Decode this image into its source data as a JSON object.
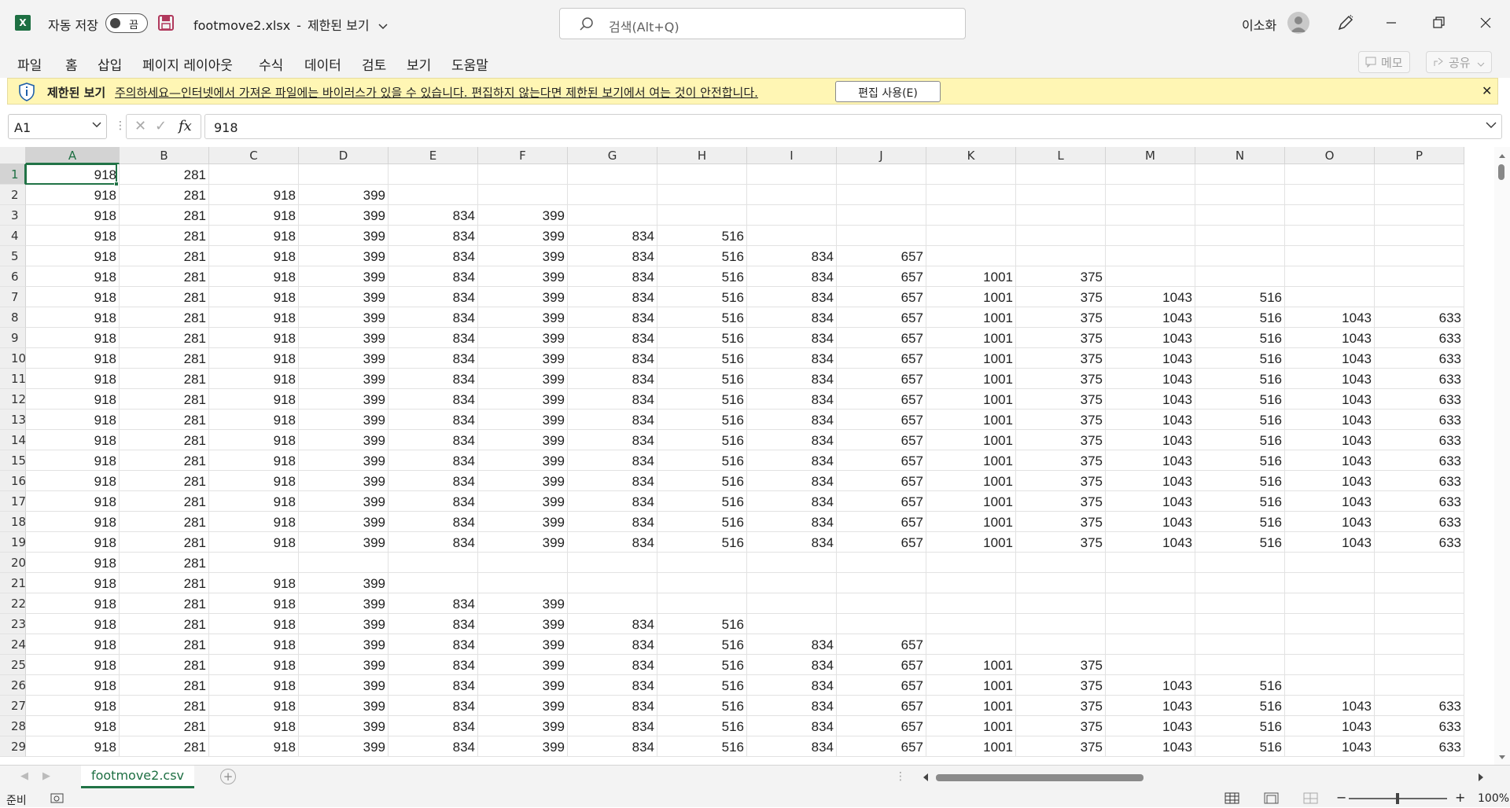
{
  "titlebar": {
    "autosave_label": "자동 저장",
    "autosave_state": "끔",
    "filename": "footmove2.xlsx",
    "separator": "-",
    "mode": "제한된 보기",
    "search_placeholder": "검색(Alt+Q)",
    "user": "이소화"
  },
  "ribbon": {
    "tabs": [
      "파일",
      "홈",
      "삽입",
      "페이지 레이아웃",
      "수식",
      "데이터",
      "검토",
      "보기",
      "도움말"
    ],
    "memo": "메모",
    "share": "공유"
  },
  "message_bar": {
    "title": "제한된 보기",
    "text": "주의하세요—인터넷에서 가져온 파일에는 바이러스가 있을 수 있습니다. 편집하지 않는다면 제한된 보기에서 여는 것이 안전합니다.",
    "button": "편집 사용(E)"
  },
  "formula_bar": {
    "name_box": "A1",
    "fx": "fx",
    "value": "918"
  },
  "grid": {
    "columns": [
      "A",
      "B",
      "C",
      "D",
      "E",
      "F",
      "G",
      "H",
      "I",
      "J",
      "K",
      "L",
      "M",
      "N",
      "O",
      "P"
    ],
    "rows": [
      {
        "n": "1",
        "c": [
          "918",
          "281"
        ]
      },
      {
        "n": "2",
        "c": [
          "918",
          "281",
          "918",
          "399"
        ]
      },
      {
        "n": "3",
        "c": [
          "918",
          "281",
          "918",
          "399",
          "834",
          "399"
        ]
      },
      {
        "n": "4",
        "c": [
          "918",
          "281",
          "918",
          "399",
          "834",
          "399",
          "834",
          "516"
        ]
      },
      {
        "n": "5",
        "c": [
          "918",
          "281",
          "918",
          "399",
          "834",
          "399",
          "834",
          "516",
          "834",
          "657"
        ]
      },
      {
        "n": "6",
        "c": [
          "918",
          "281",
          "918",
          "399",
          "834",
          "399",
          "834",
          "516",
          "834",
          "657",
          "1001",
          "375"
        ]
      },
      {
        "n": "7",
        "c": [
          "918",
          "281",
          "918",
          "399",
          "834",
          "399",
          "834",
          "516",
          "834",
          "657",
          "1001",
          "375",
          "1043",
          "516"
        ]
      },
      {
        "n": "8",
        "c": [
          "918",
          "281",
          "918",
          "399",
          "834",
          "399",
          "834",
          "516",
          "834",
          "657",
          "1001",
          "375",
          "1043",
          "516",
          "1043",
          "633"
        ]
      },
      {
        "n": "9",
        "c": [
          "918",
          "281",
          "918",
          "399",
          "834",
          "399",
          "834",
          "516",
          "834",
          "657",
          "1001",
          "375",
          "1043",
          "516",
          "1043",
          "633"
        ]
      },
      {
        "n": "10",
        "c": [
          "918",
          "281",
          "918",
          "399",
          "834",
          "399",
          "834",
          "516",
          "834",
          "657",
          "1001",
          "375",
          "1043",
          "516",
          "1043",
          "633"
        ]
      },
      {
        "n": "11",
        "c": [
          "918",
          "281",
          "918",
          "399",
          "834",
          "399",
          "834",
          "516",
          "834",
          "657",
          "1001",
          "375",
          "1043",
          "516",
          "1043",
          "633"
        ]
      },
      {
        "n": "12",
        "c": [
          "918",
          "281",
          "918",
          "399",
          "834",
          "399",
          "834",
          "516",
          "834",
          "657",
          "1001",
          "375",
          "1043",
          "516",
          "1043",
          "633"
        ]
      },
      {
        "n": "13",
        "c": [
          "918",
          "281",
          "918",
          "399",
          "834",
          "399",
          "834",
          "516",
          "834",
          "657",
          "1001",
          "375",
          "1043",
          "516",
          "1043",
          "633"
        ]
      },
      {
        "n": "14",
        "c": [
          "918",
          "281",
          "918",
          "399",
          "834",
          "399",
          "834",
          "516",
          "834",
          "657",
          "1001",
          "375",
          "1043",
          "516",
          "1043",
          "633"
        ]
      },
      {
        "n": "15",
        "c": [
          "918",
          "281",
          "918",
          "399",
          "834",
          "399",
          "834",
          "516",
          "834",
          "657",
          "1001",
          "375",
          "1043",
          "516",
          "1043",
          "633"
        ]
      },
      {
        "n": "16",
        "c": [
          "918",
          "281",
          "918",
          "399",
          "834",
          "399",
          "834",
          "516",
          "834",
          "657",
          "1001",
          "375",
          "1043",
          "516",
          "1043",
          "633"
        ]
      },
      {
        "n": "17",
        "c": [
          "918",
          "281",
          "918",
          "399",
          "834",
          "399",
          "834",
          "516",
          "834",
          "657",
          "1001",
          "375",
          "1043",
          "516",
          "1043",
          "633"
        ]
      },
      {
        "n": "18",
        "c": [
          "918",
          "281",
          "918",
          "399",
          "834",
          "399",
          "834",
          "516",
          "834",
          "657",
          "1001",
          "375",
          "1043",
          "516",
          "1043",
          "633"
        ]
      },
      {
        "n": "19",
        "c": [
          "918",
          "281",
          "918",
          "399",
          "834",
          "399",
          "834",
          "516",
          "834",
          "657",
          "1001",
          "375",
          "1043",
          "516",
          "1043",
          "633"
        ]
      },
      {
        "n": "20",
        "c": [
          "918",
          "281"
        ]
      },
      {
        "n": "21",
        "c": [
          "918",
          "281",
          "918",
          "399"
        ]
      },
      {
        "n": "22",
        "c": [
          "918",
          "281",
          "918",
          "399",
          "834",
          "399"
        ]
      },
      {
        "n": "23",
        "c": [
          "918",
          "281",
          "918",
          "399",
          "834",
          "399",
          "834",
          "516"
        ]
      },
      {
        "n": "24",
        "c": [
          "918",
          "281",
          "918",
          "399",
          "834",
          "399",
          "834",
          "516",
          "834",
          "657"
        ]
      },
      {
        "n": "25",
        "c": [
          "918",
          "281",
          "918",
          "399",
          "834",
          "399",
          "834",
          "516",
          "834",
          "657",
          "1001",
          "375"
        ]
      },
      {
        "n": "26",
        "c": [
          "918",
          "281",
          "918",
          "399",
          "834",
          "399",
          "834",
          "516",
          "834",
          "657",
          "1001",
          "375",
          "1043",
          "516"
        ]
      },
      {
        "n": "27",
        "c": [
          "918",
          "281",
          "918",
          "399",
          "834",
          "399",
          "834",
          "516",
          "834",
          "657",
          "1001",
          "375",
          "1043",
          "516",
          "1043",
          "633"
        ]
      },
      {
        "n": "28",
        "c": [
          "918",
          "281",
          "918",
          "399",
          "834",
          "399",
          "834",
          "516",
          "834",
          "657",
          "1001",
          "375",
          "1043",
          "516",
          "1043",
          "633"
        ]
      },
      {
        "n": "29",
        "c": [
          "918",
          "281",
          "918",
          "399",
          "834",
          "399",
          "834",
          "516",
          "834",
          "657",
          "1001",
          "375",
          "1043",
          "516",
          "1043",
          "633"
        ]
      }
    ]
  },
  "sheet_tabs": [
    "footmove2.csv"
  ],
  "status": {
    "ready": "준비",
    "zoom": "100%"
  },
  "colors": {
    "accent": "#217346",
    "message_bar": "#fff6b4"
  }
}
